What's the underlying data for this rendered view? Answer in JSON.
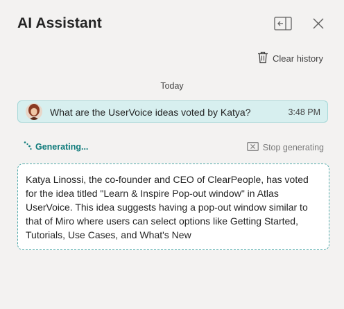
{
  "header": {
    "title": "AI Assistant"
  },
  "toolbar": {
    "clear_history_label": "Clear history"
  },
  "conversation": {
    "date_separator": "Today",
    "user_message": {
      "text": "What are the UserVoice ideas voted by Katya?",
      "time": "3:48 PM"
    },
    "status": {
      "generating_label": "Generating...",
      "stop_label": "Stop generating"
    },
    "response_text": "Katya Linossi, the co-founder and CEO of ClearPeople, has voted for the idea titled \"Learn & Inspire Pop-out window\" in Atlas UserVoice. This idea suggests having a pop-out window similar to that of Miro where users can select options like Getting Started, Tutorials, Use Cases, and What's New"
  },
  "icons": {
    "dock": "panel-dock-left-icon",
    "close": "close-icon",
    "clear": "trash-icon",
    "generating": "sparkle-dots-icon",
    "stop": "stop-square-icon"
  },
  "colors": {
    "background": "#f3f2f1",
    "user_bubble": "#d7efef",
    "accent": "#0f7b7b",
    "response_border": "#4faaaa"
  }
}
